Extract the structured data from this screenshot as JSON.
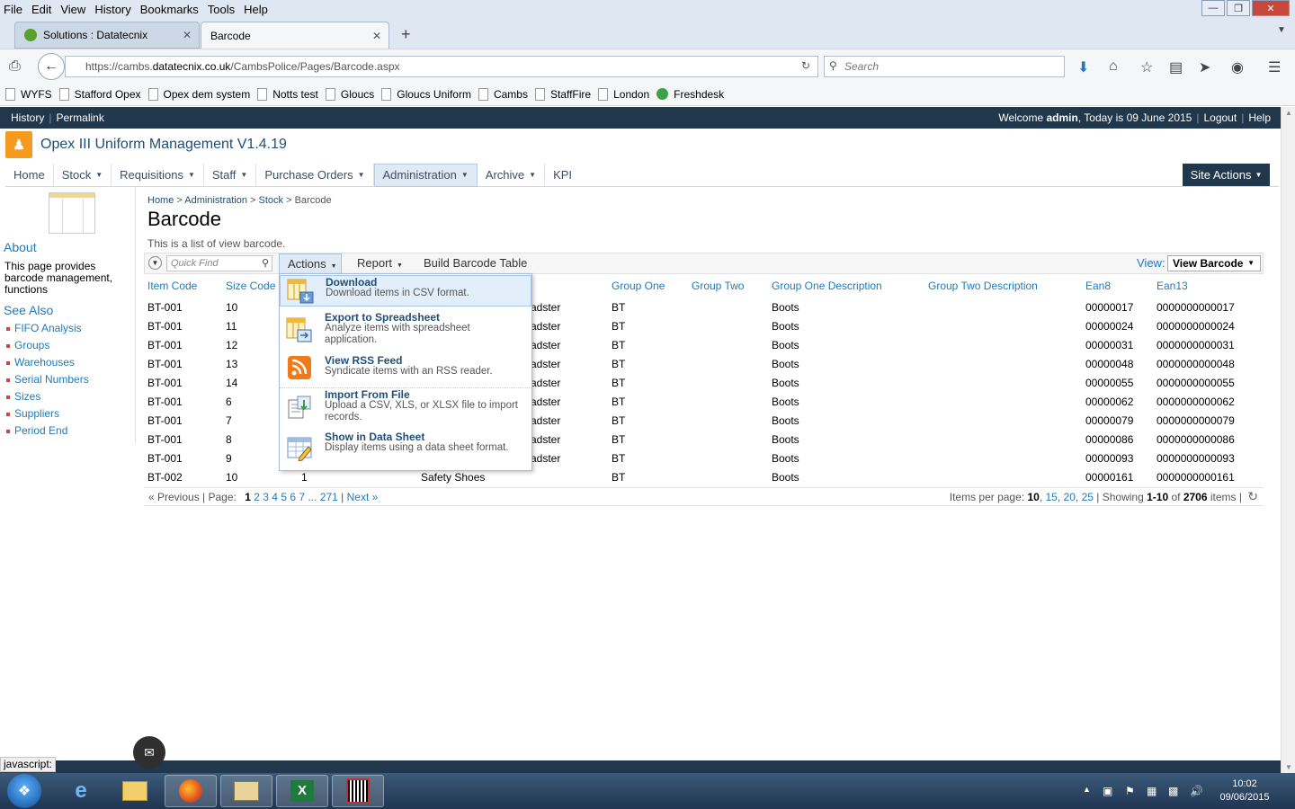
{
  "browser": {
    "menu": [
      "File",
      "Edit",
      "View",
      "History",
      "Bookmarks",
      "Tools",
      "Help"
    ],
    "tabs": [
      {
        "title": "Solutions : Datatecnix"
      },
      {
        "title": "Barcode"
      }
    ],
    "url_prefix": "https://cambs.",
    "url_domain": "datatecnix.co.uk",
    "url_path": "/CambsPolice/Pages/Barcode.aspx",
    "search_placeholder": "Search",
    "bookmarks": [
      "WYFS",
      "Stafford Opex",
      "Opex dem system",
      "Notts test",
      "Gloucs",
      "Gloucs Uniform",
      "Cambs",
      "StaffFire",
      "London",
      "Freshdesk"
    ],
    "status_text": "javascript:"
  },
  "sharepoint": {
    "top_left": [
      "History",
      "Permalink"
    ],
    "welcome_prefix": "Welcome ",
    "user": "admin",
    "today_text": ", Today is 09 June 2015",
    "top_links": [
      "Logout",
      "Help"
    ],
    "app_title": "Opex III Uniform Management V1.4.19",
    "nav": [
      {
        "label": "Home",
        "dropdown": false
      },
      {
        "label": "Stock",
        "dropdown": true
      },
      {
        "label": "Requisitions",
        "dropdown": true
      },
      {
        "label": "Staff",
        "dropdown": true
      },
      {
        "label": "Purchase Orders",
        "dropdown": true
      },
      {
        "label": "Administration",
        "dropdown": true,
        "active": true
      },
      {
        "label": "Archive",
        "dropdown": true
      },
      {
        "label": "KPI",
        "dropdown": false
      }
    ],
    "site_actions": "Site Actions"
  },
  "sidebar": {
    "about_heading": "About",
    "about_text": "This page provides barcode management, functions",
    "see_also_heading": "See Also",
    "links": [
      "FIFO Analysis",
      "Groups",
      "Warehouses",
      "Serial Numbers",
      "Sizes",
      "Suppliers",
      "Period End"
    ]
  },
  "main": {
    "breadcrumb": [
      "Home",
      "Administration",
      "Stock",
      "Barcode"
    ],
    "title": "Barcode",
    "description": "This is a list of view barcode.",
    "quick_find_placeholder": "Quick Find",
    "toolbar": {
      "actions": "Actions",
      "report": "Report",
      "build": "Build Barcode Table",
      "view_label": "View:",
      "view_value": "View Barcode"
    }
  },
  "table": {
    "headers": [
      "Item Code",
      "Size Code",
      "Group One",
      "Group Two",
      "Group One Description",
      "Group Two Description",
      "Ean8",
      "Ean13"
    ],
    "rows": [
      {
        "item": "BT-001",
        "size": "10",
        "col3": "adster",
        "g1": "BT",
        "g2": "",
        "g1d": "Boots",
        "g2d": "",
        "ean8": "00000017",
        "ean13": "0000000000017"
      },
      {
        "item": "BT-001",
        "size": "11",
        "col3": "adster",
        "g1": "BT",
        "g2": "",
        "g1d": "Boots",
        "g2d": "",
        "ean8": "00000024",
        "ean13": "0000000000024"
      },
      {
        "item": "BT-001",
        "size": "12",
        "col3": "adster",
        "g1": "BT",
        "g2": "",
        "g1d": "Boots",
        "g2d": "",
        "ean8": "00000031",
        "ean13": "0000000000031"
      },
      {
        "item": "BT-001",
        "size": "13",
        "col3": "adster",
        "g1": "BT",
        "g2": "",
        "g1d": "Boots",
        "g2d": "",
        "ean8": "00000048",
        "ean13": "0000000000048"
      },
      {
        "item": "BT-001",
        "size": "14",
        "col3": "adster",
        "g1": "BT",
        "g2": "",
        "g1d": "Boots",
        "g2d": "",
        "ean8": "00000055",
        "ean13": "0000000000055"
      },
      {
        "item": "BT-001",
        "size": "6",
        "col3": "adster",
        "g1": "BT",
        "g2": "",
        "g1d": "Boots",
        "g2d": "",
        "ean8": "00000062",
        "ean13": "0000000000062"
      },
      {
        "item": "BT-001",
        "size": "7",
        "col3": "adster",
        "g1": "BT",
        "g2": "",
        "g1d": "Boots",
        "g2d": "",
        "ean8": "00000079",
        "ean13": "0000000000079"
      },
      {
        "item": "BT-001",
        "size": "8",
        "col3": "adster",
        "g1": "BT",
        "g2": "",
        "g1d": "Boots",
        "g2d": "",
        "ean8": "00000086",
        "ean13": "0000000000086"
      },
      {
        "item": "BT-001",
        "size": "9",
        "col3": "adster",
        "g1": "BT",
        "g2": "",
        "g1d": "Boots",
        "g2d": "",
        "ean8": "00000093",
        "ean13": "0000000000093"
      },
      {
        "item": "BT-002",
        "size": "10",
        "col3": "1",
        "col4": "Safety Shoes",
        "g1": "BT",
        "g2": "",
        "g1d": "Boots",
        "g2d": "",
        "ean8": "00000161",
        "ean13": "0000000000161"
      }
    ]
  },
  "pager": {
    "prev": "« Previous",
    "page_label": "Page:",
    "current": "1",
    "pages": [
      "2",
      "3",
      "4",
      "5",
      "6",
      "7"
    ],
    "ellipsis": "...",
    "last": "271",
    "next": "Next »",
    "items_per_page_label": "Items per page:",
    "per_page_current": "10",
    "per_page_options": [
      "15",
      "20",
      "25"
    ],
    "showing_prefix": "Showing ",
    "showing_range": "1-10",
    "of": " of ",
    "total": "2706",
    "items_suffix": " items"
  },
  "actions_menu": [
    {
      "title": "Download",
      "desc": "Download items in CSV format.",
      "icon": "csv-download-icon"
    },
    {
      "title": "Export to Spreadsheet",
      "desc": "Analyze items with spreadsheet application.",
      "icon": "spreadsheet-icon"
    },
    {
      "title": "View RSS Feed",
      "desc": "Syndicate items with an RSS reader.",
      "icon": "rss-icon"
    },
    {
      "title": "Import From File",
      "desc": "Upload a CSV, XLS, or XLSX file to import records.",
      "icon": "import-file-icon"
    },
    {
      "title": "Show in Data Sheet",
      "desc": "Display items using a data sheet format.",
      "icon": "datasheet-icon"
    }
  ],
  "taskbar": {
    "time": "10:02",
    "date": "09/06/2015"
  },
  "colors": {
    "sp_dark": "#21374c",
    "link_blue": "#1e7bbd",
    "title_blue": "#1f4e79",
    "logo_orange": "#f39a1f"
  }
}
